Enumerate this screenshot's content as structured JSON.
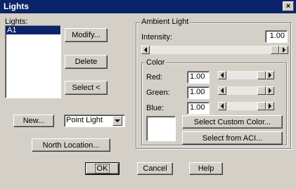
{
  "window": {
    "title": "Lights",
    "close": "×"
  },
  "lights": {
    "label": "Lights:",
    "items": [
      "A1"
    ]
  },
  "buttons": {
    "modify": "Modify...",
    "delete": "Delete",
    "select": "Select <",
    "new": "New...",
    "north": "North Location...",
    "ok": "OK",
    "cancel": "Cancel",
    "help": "Help"
  },
  "light_type": {
    "value": "Point Light"
  },
  "ambient": {
    "title": "Ambient Light",
    "intensity_label": "Intensity:",
    "intensity_value": "1.00",
    "intensity_level": 1.0
  },
  "color": {
    "title": "Color",
    "red_label": "Red:",
    "red_value": "1.00",
    "green_label": "Green:",
    "green_value": "1.00",
    "blue_label": "Blue:",
    "blue_value": "1.00",
    "swatch": "#ffffff",
    "select_custom": "Select Custom Color...",
    "select_aci": "Select from ACI..."
  }
}
